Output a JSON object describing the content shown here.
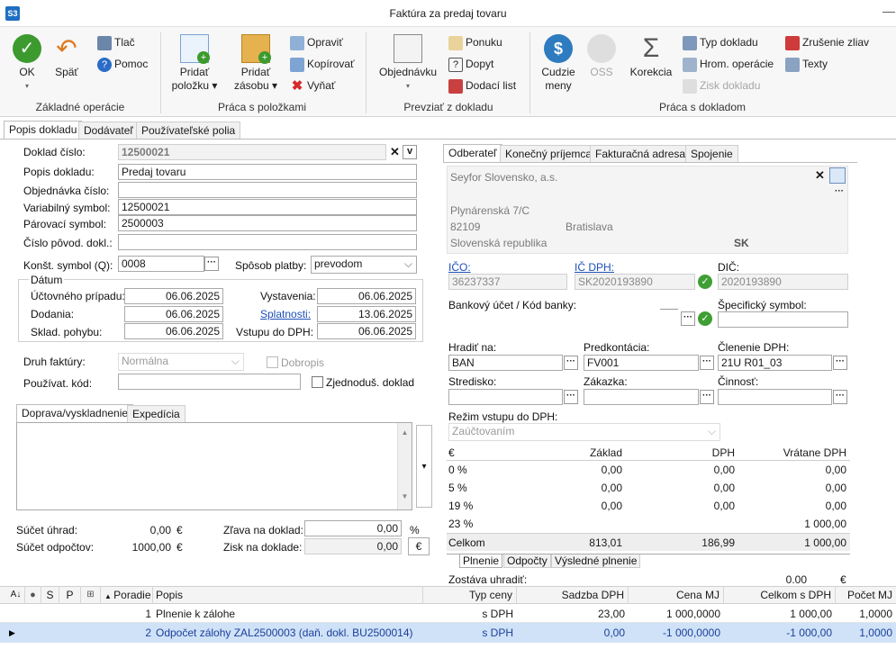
{
  "window": {
    "logo": "S3",
    "title": "Faktúra za predaj tovaru",
    "minimize": "—"
  },
  "ribbon": {
    "ok": "OK",
    "spat": "Späť",
    "tlac": "Tlač",
    "pomoc": "Pomoc",
    "grp1": "Základné operácie",
    "pridat_polozku": "Pridať",
    "pridat_polozku2": "položku",
    "pridat_zasobu": "Pridať",
    "pridat_zasobu2": "zásobu",
    "opravit": "Opraviť",
    "kopirovat": "Kopírovať",
    "vyňat": "Vyňať",
    "grp2": "Práca s položkami",
    "objednavku": "Objednávku",
    "ponuku": "Ponuku",
    "dopyt": "Dopyt",
    "dodaci_list": "Dodací list",
    "grp3": "Prevziať z dokladu",
    "cudzie": "Cudzie",
    "meny": "meny",
    "oss": "OSS",
    "korekcia": "Korekcia",
    "typ_dokladu": "Typ dokladu",
    "hrom_operacie": "Hrom. operácie",
    "zisk_dokladu": "Zisk dokladu",
    "zrusenie_zliav": "Zrušenie zliav",
    "texty": "Texty",
    "grp4": "Práca s dokladom"
  },
  "tabs": [
    "Popis dokladu",
    "Dodávateľ",
    "Používateľské polia"
  ],
  "left": {
    "doklad_cislo_l": "Doklad číslo:",
    "doklad_cislo": "12500021",
    "popis_l": "Popis dokladu:",
    "popis": "Predaj tovaru",
    "objednavka_l": "Objednávka číslo:",
    "objednavka": "",
    "variabilny_l": "Variabilný symbol:",
    "variabilny": "12500021",
    "parovaci_l": "Párovací symbol:",
    "parovaci": "2500003",
    "povod_l": "Číslo pôvod. dokl.:",
    "povod": "",
    "konst_l": "Konšt. symbol (Q):",
    "konst": "0008",
    "sposob_l": "Spôsob platby:",
    "sposob": "prevodom",
    "datum_l": "Dátum",
    "uctovneho_l": "Účtovného prípadu:",
    "uctovneho": "06.06.2025",
    "dodania_l": "Dodania:",
    "dodania": "06.06.2025",
    "sklad_l": "Sklad. pohybu:",
    "sklad": "06.06.2025",
    "vystavenia_l": "Vystavenia:",
    "vystavenia": "06.06.2025",
    "splatnosti_l": "Splatnosti:",
    "splatnosti": "13.06.2025",
    "vstupu_l": "Vstupu do DPH:",
    "vstupu": "06.06.2025",
    "druh_l": "Druh faktúry:",
    "druh": "Normálna",
    "dobropis": "Dobropis",
    "pouzivat_l": "Používat. kód:",
    "zjednodus": "Zjednoduš. doklad",
    "sub_tabs": [
      "Doprava/vyskladnenie",
      "Expedícia"
    ],
    "sucet_uhrad_l": "Súčet úhrad:",
    "sucet_uhrad": "0,00",
    "sucet_odpoctov_l": "Súčet odpočtov:",
    "sucet_odpoctov": "1000,00",
    "eur": "€",
    "zlava_l": "Zľava na doklad:",
    "zlava": "0,00",
    "pct": "%",
    "zisk_l": "Zisk na doklade:",
    "zisk": "0,00"
  },
  "right": {
    "tabs": [
      "Odberateľ",
      "Konečný príjemca",
      "Fakturačná adresa",
      "Spojenie"
    ],
    "company": "Seyfor Slovensko, a.s.",
    "street": "Plynárenská 7/C",
    "zip": "82109",
    "city": "Bratislava",
    "country": "Slovenská republika",
    "country_code": "SK",
    "ico_l": "IČO:",
    "ico": "36237337",
    "icdph_l": "IČ DPH:",
    "icdph": "SK2020193890",
    "dic_l": "DIČ:",
    "dic": "2020193890",
    "bank_l": "Bankový účet / Kód banky:",
    "spec_l": "Špecifický symbol:",
    "hradit_l": "Hradiť na:",
    "hradit": "BAN",
    "predk_l": "Predkontácia:",
    "predk": "FV001",
    "clen_l": "Členenie DPH:",
    "clen": "21U R01_03",
    "stred_l": "Stredisko:",
    "zakazka_l": "Zákazka:",
    "cinnost_l": "Činnosť:",
    "rezim_l": "Režim vstupu do DPH:",
    "rezim": "Zaúčtovaním",
    "vat_hdr": [
      "€",
      "Základ",
      "DPH",
      "Vrátane DPH"
    ],
    "vat_rows": [
      [
        "0 %",
        "0,00",
        "0,00",
        "0,00"
      ],
      [
        "5 %",
        "0,00",
        "0,00",
        "0,00"
      ],
      [
        "19 %",
        "0,00",
        "0,00",
        "0,00"
      ],
      [
        "23 %",
        "",
        "",
        "1 000,00"
      ]
    ],
    "celkom": [
      "Celkom",
      "813,01",
      "186,99",
      "1 000,00"
    ],
    "sub_tabs": [
      "Plnenie",
      "Odpočty",
      "Výsledné plnenie"
    ],
    "zostava_l": "Zostáva uhradiť:",
    "zostava": "0.00",
    "zostava_cur": "€"
  },
  "grid": {
    "headers": [
      "S",
      "P",
      "Poradie",
      "Popis",
      "Typ ceny",
      "Sadzba DPH",
      "Cena MJ",
      "Celkom s DPH",
      "Počet MJ"
    ],
    "rows": [
      [
        "1",
        "Plnenie k zálohe",
        "s DPH",
        "23,00",
        "1 000,0000",
        "1 000,00",
        "1,0000"
      ],
      [
        "2",
        "Odpočet zálohy ZAL2500003 (daň. dokl. BU2500014)",
        "s DPH",
        "0,00",
        "-1 000,0000",
        "-1 000,00",
        "1,0000"
      ]
    ]
  }
}
